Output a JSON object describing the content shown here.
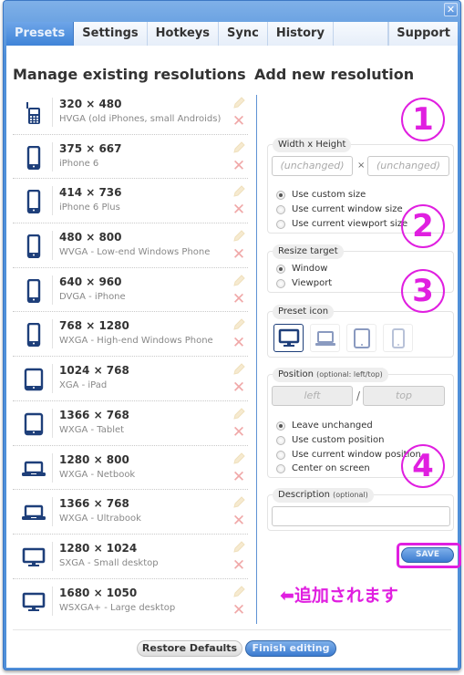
{
  "window": {
    "close_icon": "close-icon"
  },
  "tabs": [
    {
      "label": "Presets",
      "active": true
    },
    {
      "label": "Settings"
    },
    {
      "label": "Hotkeys"
    },
    {
      "label": "Sync"
    },
    {
      "label": "History"
    },
    {
      "label": "Support"
    }
  ],
  "manage": {
    "title": "Manage existing resolutions",
    "presets": [
      {
        "resolution": "320 × 480",
        "description": "HVGA (old iPhones, small Androids)",
        "icon": "feature-phone-icon"
      },
      {
        "resolution": "375 × 667",
        "description": "iPhone 6",
        "icon": "phone-icon"
      },
      {
        "resolution": "414 × 736",
        "description": "iPhone 6 Plus",
        "icon": "phone-icon"
      },
      {
        "resolution": "480 × 800",
        "description": "WVGA - Low-end Windows Phone",
        "icon": "phone-icon"
      },
      {
        "resolution": "640 × 960",
        "description": "DVGA - iPhone",
        "icon": "phone-icon"
      },
      {
        "resolution": "768 × 1280",
        "description": "WXGA - High-end Windows Phone",
        "icon": "phone-icon"
      },
      {
        "resolution": "1024 × 768",
        "description": "XGA - iPad",
        "icon": "tablet-icon"
      },
      {
        "resolution": "1366 × 768",
        "description": "WXGA - Tablet",
        "icon": "tablet-icon"
      },
      {
        "resolution": "1280 × 800",
        "description": "WXGA - Netbook",
        "icon": "laptop-icon"
      },
      {
        "resolution": "1366 × 768",
        "description": "WXGA - Ultrabook",
        "icon": "laptop-icon"
      },
      {
        "resolution": "1280 × 1024",
        "description": "SXGA - Small desktop",
        "icon": "desktop-icon"
      },
      {
        "resolution": "1680 × 1050",
        "description": "WSXGA+ - Large desktop",
        "icon": "desktop-icon"
      }
    ]
  },
  "add": {
    "title": "Add new resolution",
    "size": {
      "legend": "Width x Height",
      "width_placeholder": "(unchanged)",
      "height_placeholder": "(unchanged)",
      "separator": "×",
      "options": [
        {
          "label": "Use custom size",
          "checked": true
        },
        {
          "label": "Use current window size",
          "checked": false
        },
        {
          "label": "Use current viewport size",
          "checked": false
        }
      ]
    },
    "target": {
      "legend": "Resize target",
      "options": [
        {
          "label": "Window",
          "checked": true
        },
        {
          "label": "Viewport",
          "checked": false
        }
      ]
    },
    "icon": {
      "legend": "Preset icon",
      "options": [
        "desktop",
        "laptop",
        "tablet",
        "phone"
      ],
      "selected": "desktop"
    },
    "position": {
      "legend": "Position",
      "legend_hint": "(optional: left/top)",
      "left_placeholder": "left",
      "top_placeholder": "top",
      "separator": "/",
      "options": [
        {
          "label": "Leave unchanged",
          "checked": true
        },
        {
          "label": "Use custom position",
          "checked": false
        },
        {
          "label": "Use current window position",
          "checked": false
        },
        {
          "label": "Center on screen",
          "checked": false
        }
      ]
    },
    "description": {
      "legend": "Description",
      "legend_hint": "(optional)",
      "value": ""
    },
    "save_label": "SAVE"
  },
  "annotations": {
    "badges": [
      "1",
      "2",
      "3",
      "4"
    ],
    "note": "⬅追加されます",
    "color": "#e01fe0"
  },
  "footer": {
    "restore_label": "Restore Defaults",
    "finish_label": "Finish editing"
  },
  "colors": {
    "accent": "#4f8fd9",
    "icon": "#1e3f7a",
    "delete": "#f0a8a8"
  }
}
